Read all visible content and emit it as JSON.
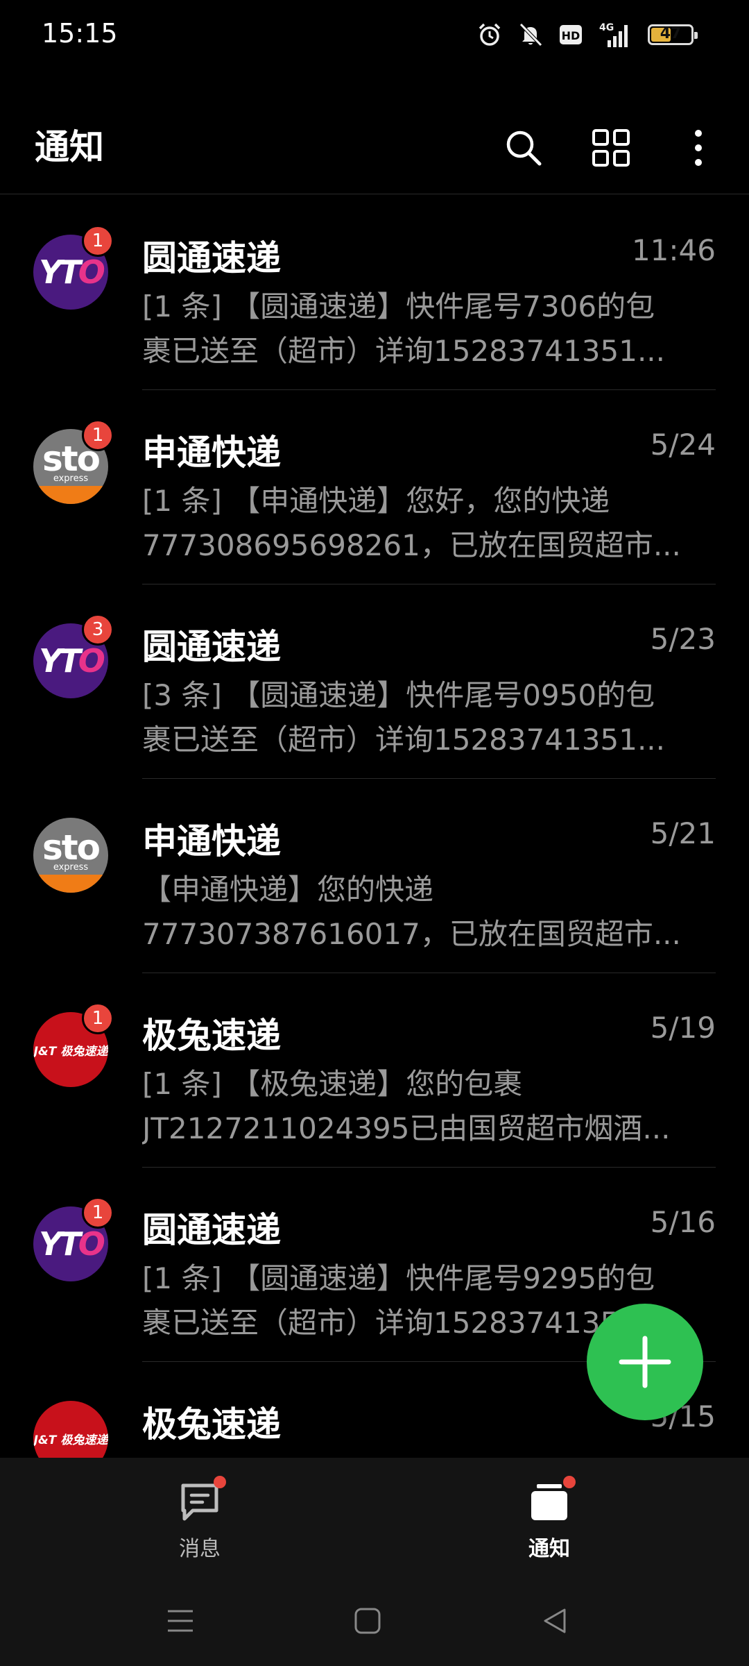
{
  "status_bar": {
    "time": "15:15",
    "network": "4G",
    "hd_label": "HD",
    "battery": "47",
    "icons": [
      "alarm-icon",
      "mute-icon",
      "hd-icon",
      "signal-icon",
      "battery-icon"
    ]
  },
  "app_bar": {
    "title": "通知",
    "actions": [
      "search-icon",
      "grid-icon",
      "more-icon"
    ]
  },
  "notifications": [
    {
      "sender": "圆通速递",
      "logo": "yto",
      "badge": "1",
      "time": "11:46",
      "line1": "[1 条] 【圆通速递】快件尾号7306的包",
      "line2": "裹已送至（超市）详询15283741351..."
    },
    {
      "sender": "申通快递",
      "logo": "sto",
      "badge": "1",
      "time": "5/24",
      "line1": "[1 条] 【申通快递】您好，您的快递",
      "line2": "777308695698261，已放在国贸超市..."
    },
    {
      "sender": "圆通速递",
      "logo": "yto",
      "badge": "3",
      "time": "5/23",
      "line1": "[3 条] 【圆通速递】快件尾号0950的包",
      "line2": "裹已送至（超市）详询15283741351..."
    },
    {
      "sender": "申通快递",
      "logo": "sto",
      "badge": "",
      "time": "5/21",
      "line1": "【申通快递】您的快递",
      "line2": "777307387616017，已放在国贸超市..."
    },
    {
      "sender": "极兔速递",
      "logo": "jt",
      "badge": "1",
      "time": "5/19",
      "line1": "[1 条] 【极兔速递】您的包裹",
      "line2": "JT2127211024395已由国贸超市烟酒..."
    },
    {
      "sender": "圆通速递",
      "logo": "yto",
      "badge": "1",
      "time": "5/16",
      "line1": "[1 条] 【圆通速递】快件尾号9295的包",
      "line2": "裹已送至（超市）详询15283741351..."
    },
    {
      "sender": "极兔速递",
      "logo": "jt",
      "badge": "",
      "time": "5/15",
      "line1": "",
      "line2": ""
    }
  ],
  "logos": {
    "yto": {
      "text_a": "YT",
      "text_b": "O"
    },
    "sto": {
      "text": "sto",
      "sub": "express"
    },
    "jt": {
      "text": "J&T 极兔速递"
    }
  },
  "fab": {
    "icon": "plus-icon",
    "color": "#2ec152"
  },
  "bottom_nav": {
    "tabs": [
      {
        "label": "消息",
        "icon": "message-icon",
        "active": false
      },
      {
        "label": "通知",
        "icon": "notification-icon",
        "active": true
      }
    ]
  },
  "system_nav": [
    "menu-icon",
    "home-icon",
    "back-icon"
  ],
  "colors": {
    "badge": "#e8453c",
    "secondary_text": "#9a9a9a",
    "yto": "#4a1a7f",
    "sto_band": "#f07c16",
    "jt": "#c8111b"
  }
}
